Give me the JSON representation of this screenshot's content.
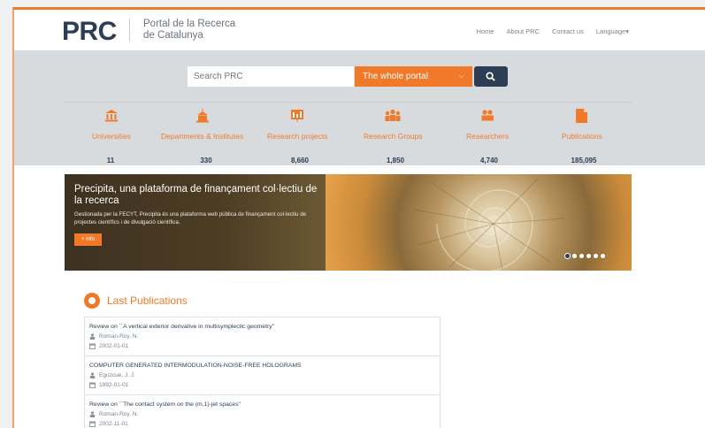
{
  "header": {
    "logo": "PRC",
    "subtitle_line1": "Portal de la Recerca",
    "subtitle_line2": "de Catalunya",
    "nav": [
      "Home",
      "About PRC",
      "Contact us",
      "Language▾"
    ]
  },
  "search": {
    "placeholder": "Search PRC",
    "scope": "The whole portal"
  },
  "categories": [
    {
      "label": "Universities",
      "count": "11",
      "icon": "university-icon"
    },
    {
      "label": "Departments & Institutes",
      "count": "330",
      "icon": "institution-icon"
    },
    {
      "label": "Research projects",
      "count": "8,660",
      "icon": "projects-icon"
    },
    {
      "label": "Research Groups",
      "count": "1,850",
      "icon": "groups-icon"
    },
    {
      "label": "Researchers",
      "count": "4,740",
      "icon": "researchers-icon"
    },
    {
      "label": "Publications",
      "count": "185,095",
      "icon": "publications-icon"
    }
  ],
  "banner": {
    "title": "Precipita, una plataforma de finançament col·lectiu de la recerca",
    "text": "Gestionada per la FECYT, Precipita és una plataforma web pública de finançament col·lectiu de projectes científics i de divulgació científica.",
    "button": "+ info",
    "slides": 6,
    "active_slide": 1
  },
  "publications": {
    "title": "Last Publications",
    "items": [
      {
        "title": "Review on ``A vertical exterior derivative in multisymplectic geometry''",
        "author": "Roman-Roy, N.",
        "date": "2002-01-01"
      },
      {
        "title": "COMPUTER GENERATED INTERMODULATION-NOISE-FREE HOLOGRAMS",
        "author": "Egozcue, J. J.",
        "date": "1992-01-01"
      },
      {
        "title": "Review on ``The contact system on the (m,1)-jet spaces''",
        "author": "Roman-Roy, N.",
        "date": "2002-11-01"
      }
    ]
  },
  "colors": {
    "accent": "#f07a2a",
    "dark": "#2c3e55"
  }
}
